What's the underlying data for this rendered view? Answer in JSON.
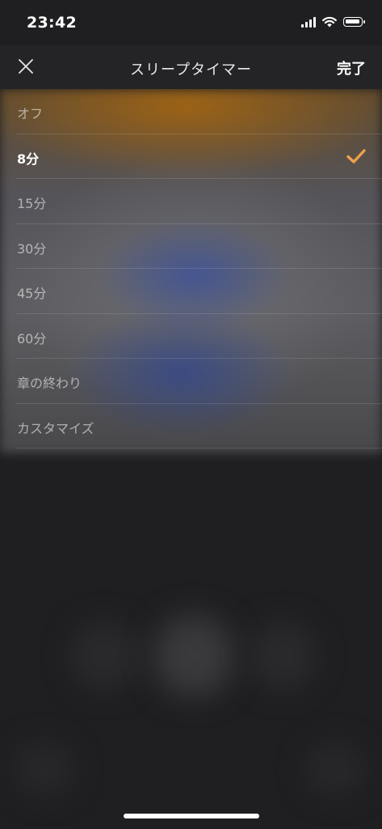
{
  "status_bar": {
    "time": "23:42"
  },
  "nav": {
    "title": "スリープタイマー",
    "done_label": "完了"
  },
  "options": [
    {
      "label": "オフ",
      "selected": false
    },
    {
      "label": "8分",
      "selected": true
    },
    {
      "label": "15分",
      "selected": false
    },
    {
      "label": "30分",
      "selected": false
    },
    {
      "label": "45分",
      "selected": false
    },
    {
      "label": "60分",
      "selected": false
    },
    {
      "label": "章の終わり",
      "selected": false
    },
    {
      "label": "カスタマイズ",
      "selected": false
    }
  ],
  "colors": {
    "accent": "#f0a04b",
    "background": "#1f1f21"
  }
}
